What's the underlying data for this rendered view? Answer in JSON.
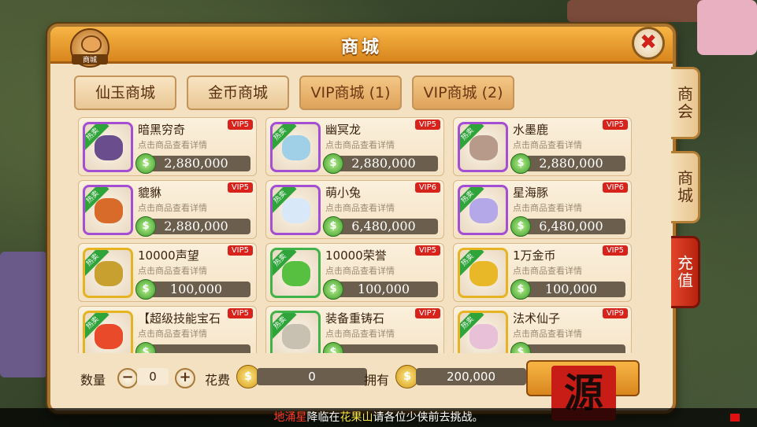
{
  "window": {
    "title": "商城",
    "badge_label": "商城"
  },
  "tabs": [
    {
      "label": "仙玉商城",
      "active": false
    },
    {
      "label": "金币商城",
      "active": false
    },
    {
      "label": "VIP商城 (1)",
      "active": true
    },
    {
      "label": "VIP商城 (2)",
      "active": true
    }
  ],
  "side_tabs": [
    "商会",
    "商城",
    "充值"
  ],
  "items": [
    {
      "name": "暗黑穷奇",
      "desc": "点击商品查看详情",
      "price": "2,880,000",
      "vip": "VIP5",
      "hot": "热卖",
      "frame": "purple",
      "art": "#6a4d8c"
    },
    {
      "name": "幽冥龙",
      "desc": "点击商品查看详情",
      "price": "2,880,000",
      "vip": "VIP5",
      "hot": "热卖",
      "frame": "purple",
      "art": "#9fd0e8"
    },
    {
      "name": "水墨鹿",
      "desc": "点击商品查看详情",
      "price": "2,880,000",
      "vip": "VIP5",
      "hot": "热卖",
      "frame": "purple",
      "art": "#b89a8a"
    },
    {
      "name": "貔貅",
      "desc": "点击商品查看详情",
      "price": "2,880,000",
      "vip": "VIP5",
      "hot": "热卖",
      "frame": "purple",
      "art": "#d86a2a"
    },
    {
      "name": "萌小兔",
      "desc": "点击商品查看详情",
      "price": "6,480,000",
      "vip": "VIP6",
      "hot": "热卖",
      "frame": "purple",
      "art": "#d8e8f8"
    },
    {
      "name": "星海豚",
      "desc": "点击商品查看详情",
      "price": "6,480,000",
      "vip": "VIP6",
      "hot": "热卖",
      "frame": "purple",
      "art": "#b4a8e8"
    },
    {
      "name": "10000声望",
      "desc": "点击商品查看详情",
      "price": "100,000",
      "vip": "VIP5",
      "hot": "热卖",
      "frame": "gold",
      "art": "#c8a030"
    },
    {
      "name": "10000荣誉",
      "desc": "点击商品查看详情",
      "price": "100,000",
      "vip": "VIP5",
      "hot": "热卖",
      "frame": "green",
      "art": "#58c040"
    },
    {
      "name": "1万金币",
      "desc": "点击商品查看详情",
      "price": "100,000",
      "vip": "VIP5",
      "hot": "热卖",
      "frame": "gold",
      "art": "#e8b828"
    },
    {
      "name": "【超级技能宝石",
      "desc": "点击商品查看详情",
      "price": "",
      "vip": "VIP5",
      "hot": "热卖",
      "frame": "gold",
      "art": "#e84a2a"
    },
    {
      "name": "装备重铸石",
      "desc": "点击商品查看详情",
      "price": "",
      "vip": "VIP7",
      "hot": "热卖",
      "frame": "green",
      "art": "#c8c0b0"
    },
    {
      "name": "法术仙子",
      "desc": "点击商品查看详情",
      "price": "",
      "vip": "VIP9",
      "hot": "热卖",
      "frame": "gold",
      "art": "#e8c0d8"
    }
  ],
  "footer": {
    "qty_label": "数量",
    "qty_value": "0",
    "minus": "−",
    "plus": "+",
    "cost_label": "花费",
    "cost_value": "0",
    "own_label": "拥有",
    "own_value": "200,000",
    "coin_glyph": "$",
    "seal_glyph": "源"
  },
  "marquee": {
    "part1": "地涌星",
    "part2": "降临在",
    "part3": "花果山",
    "part4": "请各位少侠前去挑战。"
  },
  "colors": {
    "accent": "#d9861d",
    "vip_red": "#d8231d",
    "price_box": "#6c5e4c"
  }
}
